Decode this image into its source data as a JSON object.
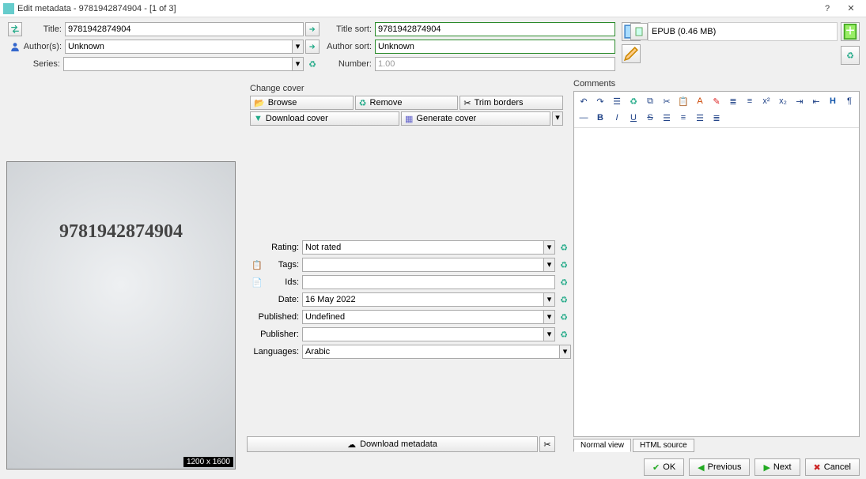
{
  "window": {
    "title": "Edit metadata - 9781942874904 -  [1 of 3]"
  },
  "fields": {
    "title_label": "Title:",
    "title_value": "9781942874904",
    "authors_label": "Author(s):",
    "authors_value": "Unknown",
    "series_label": "Series:",
    "series_value": "",
    "titlesort_label": "Title sort:",
    "titlesort_value": "9781942874904",
    "authorsort_label": "Author sort:",
    "authorsort_value": "Unknown",
    "number_label": "Number:",
    "number_value": "1.00"
  },
  "cover": {
    "section": "Change cover",
    "browse": "Browse",
    "remove": "Remove",
    "trim": "Trim borders",
    "download": "Download cover",
    "generate": "Generate cover",
    "text": "9781942874904",
    "dimensions": "1200 x 1600"
  },
  "meta": {
    "rating_label": "Rating:",
    "rating_value": "Not rated",
    "tags_label": "Tags:",
    "tags_value": "",
    "ids_label": "Ids:",
    "ids_value": "",
    "date_label": "Date:",
    "date_value": "16 May 2022",
    "published_label": "Published:",
    "published_value": "Undefined",
    "publisher_label": "Publisher:",
    "publisher_value": "",
    "languages_label": "Languages:",
    "languages_value": "Arabic"
  },
  "format": {
    "name": "EPUB (0.46 MB)"
  },
  "comments": {
    "label": "Comments",
    "normal": "Normal view",
    "html": "HTML source"
  },
  "download_metadata": "Download metadata",
  "buttons": {
    "ok": "OK",
    "prev": "Previous",
    "next": "Next",
    "cancel": "Cancel"
  }
}
